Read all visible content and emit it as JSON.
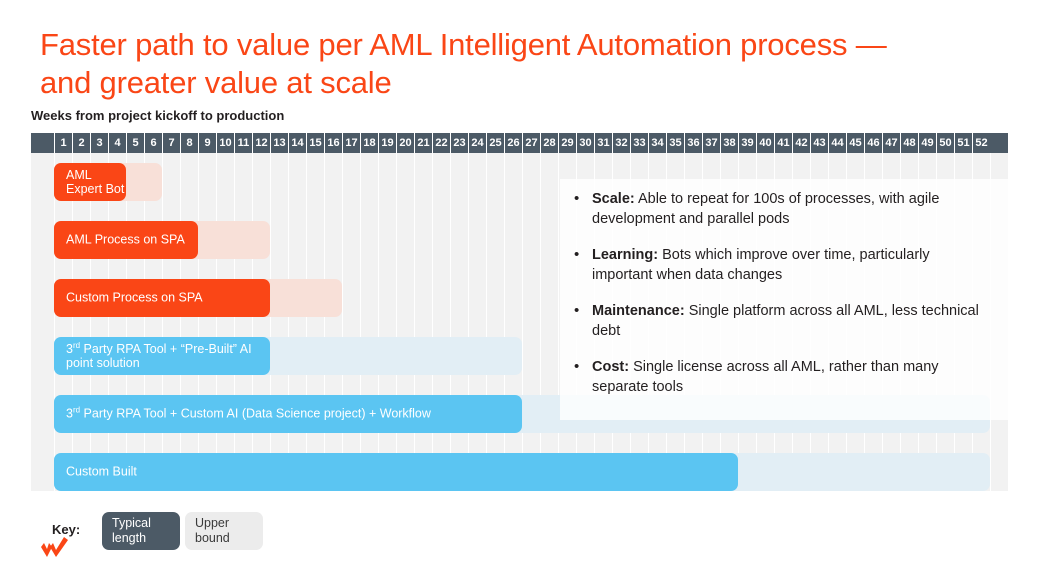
{
  "title": "Faster path to value per AML Intelligent Automation process — and greater value at scale",
  "subtitle": "Weeks from project kickoff to production",
  "colors": {
    "title_orange": "#FA4616",
    "bar_orange": "#FA4616",
    "bar_orange_light": "#F8E0D8",
    "bar_blue": "#5BC5F2",
    "bar_blue_light": "#E2EEF5",
    "header_slate": "#4C5A66",
    "plot_bg": "#F2F2F2"
  },
  "chart_data": {
    "type": "bar",
    "title": "Faster path to value per AML Intelligent Automation process — and greater value at scale",
    "xlabel": "Weeks from project kickoff to production",
    "ylabel": "",
    "xlim": [
      0,
      52
    ],
    "x_tick_labels": [
      "1",
      "2",
      "3",
      "4",
      "5",
      "6",
      "7",
      "8",
      "9",
      "10",
      "11",
      "12",
      "13",
      "14",
      "15",
      "16",
      "17",
      "18",
      "19",
      "20",
      "21",
      "22",
      "23",
      "24",
      "25",
      "26",
      "27",
      "28",
      "29",
      "30",
      "31",
      "32",
      "33",
      "34",
      "35",
      "36",
      "37",
      "38",
      "39",
      "40",
      "41",
      "42",
      "43",
      "44",
      "45",
      "46",
      "47",
      "48",
      "49",
      "50",
      "51",
      "52"
    ],
    "grid": true,
    "legend": [
      "Typical length",
      "Upper bound"
    ],
    "legend_position": "bottom-left",
    "categories": [
      "AML Expert Bot",
      "AML Process on SPA",
      "Custom Process on SPA",
      "3rd Party RPA Tool + \"Pre-Built\" AI point solution",
      "3rd Party RPA Tool + Custom AI (Data Science project) + Workflow",
      "Custom Built"
    ],
    "series": [
      {
        "name": "Typical length",
        "values": [
          4,
          8,
          12,
          12,
          26,
          38
        ]
      },
      {
        "name": "Upper bound",
        "values": [
          6,
          12,
          16,
          26,
          52,
          52
        ]
      }
    ]
  },
  "chart": {
    "weeks": [
      "1",
      "2",
      "3",
      "4",
      "5",
      "6",
      "7",
      "8",
      "9",
      "10",
      "11",
      "12",
      "13",
      "14",
      "15",
      "16",
      "17",
      "18",
      "19",
      "20",
      "21",
      "22",
      "23",
      "24",
      "25",
      "26",
      "27",
      "28",
      "29",
      "30",
      "31",
      "32",
      "33",
      "34",
      "35",
      "36",
      "37",
      "38",
      "39",
      "40",
      "41",
      "42",
      "43",
      "44",
      "45",
      "46",
      "47",
      "48",
      "49",
      "50",
      "51",
      "52"
    ],
    "bars": [
      {
        "label_line1": "AML",
        "label_line2": "Expert Bot",
        "label": "AML Expert Bot",
        "typical_weeks": 4,
        "upper_weeks": 6,
        "color": "orange",
        "two_line": true
      },
      {
        "label_line1": "AML Process on SPA",
        "label_line2": "",
        "label": "AML Process on SPA",
        "typical_weeks": 8,
        "upper_weeks": 12,
        "color": "orange",
        "two_line": false
      },
      {
        "label_line1": "Custom Process on SPA",
        "label_line2": "",
        "label": "Custom Process on SPA",
        "typical_weeks": 12,
        "upper_weeks": 16,
        "color": "orange",
        "two_line": false
      },
      {
        "label_line1": "3rd Party RPA Tool + “Pre-Built” AI",
        "label_line2": "point solution",
        "label": "3rd Party RPA Tool + “Pre-Built” AI point solution",
        "typical_weeks": 12,
        "upper_weeks": 26,
        "color": "blue",
        "two_line": true,
        "superscript": "rd"
      },
      {
        "label_line1": "3rd Party RPA Tool + Custom AI (Data Science project) + Workflow",
        "label_line2": "",
        "label": "3rd Party RPA Tool + Custom AI (Data Science project) + Workflow",
        "typical_weeks": 26,
        "upper_weeks": 52,
        "color": "blue",
        "two_line": false,
        "superscript": "rd"
      },
      {
        "label_line1": "Custom Built",
        "label_line2": "",
        "label": "Custom Built",
        "typical_weeks": 38,
        "upper_weeks": 52,
        "color": "blue",
        "two_line": false
      }
    ]
  },
  "bullets": [
    {
      "marker": "•",
      "heading": "Scale:",
      "text": " Able to repeat for 100s of processes, with agile development and parallel pods"
    },
    {
      "marker": "•",
      "heading": "Learning:",
      "text": " Bots which improve over time, particularly important when data changes"
    },
    {
      "marker": "•",
      "heading": "Maintenance:",
      "text": " Single platform across all AML,  less technical debt"
    },
    {
      "marker": "•",
      "heading": "Cost:",
      "text": " Single license across all AML,  rather than many separate tools"
    }
  ],
  "key": {
    "label": "Key:",
    "typical_line1": "Typical",
    "typical_line2": "length",
    "upper_line1": "Upper",
    "upper_line2": "bound"
  }
}
